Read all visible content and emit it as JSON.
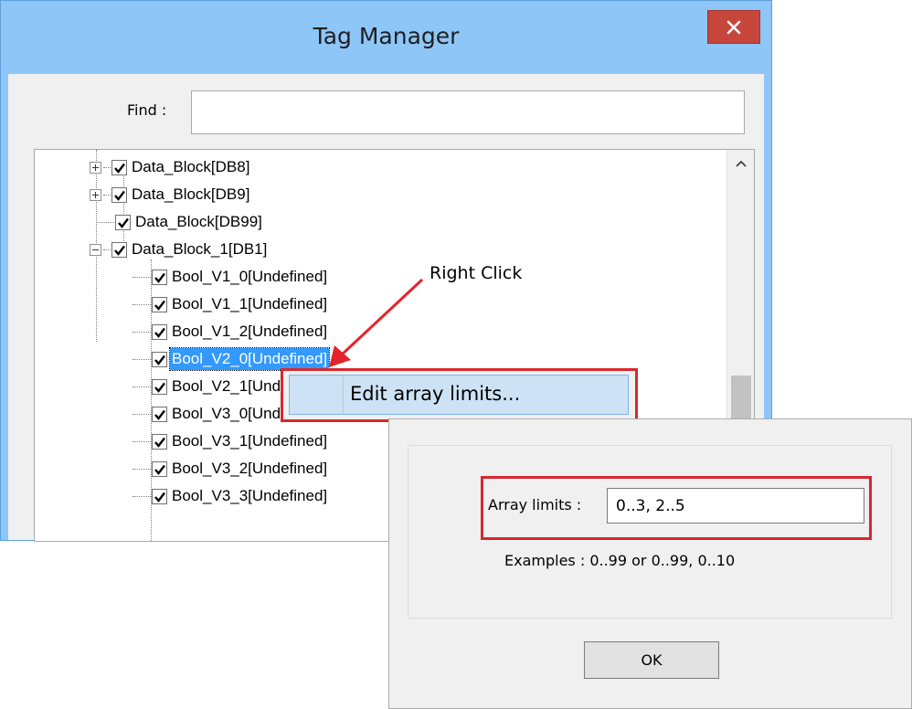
{
  "window": {
    "title": "Tag Manager",
    "close_label": "×"
  },
  "find": {
    "label": "Find :",
    "value": "",
    "placeholder": ""
  },
  "tree": {
    "nodes": [
      {
        "label": "Data_Block[DB8]",
        "checked": true,
        "expander": "plus"
      },
      {
        "label": "Data_Block[DB9]",
        "checked": true,
        "expander": "plus"
      },
      {
        "label": "Data_Block[DB99]",
        "checked": true,
        "expander": "none"
      },
      {
        "label": "Data_Block_1[DB1]",
        "checked": true,
        "expander": "minus"
      },
      {
        "label": "Bool_V1_0[Undefined]",
        "checked": true
      },
      {
        "label": "Bool_V1_1[Undefined]",
        "checked": true
      },
      {
        "label": "Bool_V1_2[Undefined]",
        "checked": true
      },
      {
        "label": "Bool_V2_0[Undefined]",
        "checked": true,
        "selected": true
      },
      {
        "label": "Bool_V2_1[Undefined]",
        "checked": true
      },
      {
        "label": "Bool_V3_0[Undefined]",
        "checked": true
      },
      {
        "label": "Bool_V3_1[Undefined]",
        "checked": true
      },
      {
        "label": "Bool_V3_2[Undefined]",
        "checked": true
      },
      {
        "label": "Bool_V3_3[Undefined]",
        "checked": true
      }
    ]
  },
  "context_menu": {
    "item_label": "Edit array limits..."
  },
  "annotation": {
    "text": "Right Click"
  },
  "dialog": {
    "limits_label": "Array limits :",
    "limits_value": "0..3, 2..5",
    "examples_text": "Examples :  0..99 or 0..99, 0..10",
    "ok_label": "OK"
  },
  "colors": {
    "title_bar": "#8ec6f8",
    "close_button": "#c7463c",
    "selection": "#3399ff",
    "highlight_frame": "#d9272e",
    "menu_hover": "#cde2f5"
  }
}
